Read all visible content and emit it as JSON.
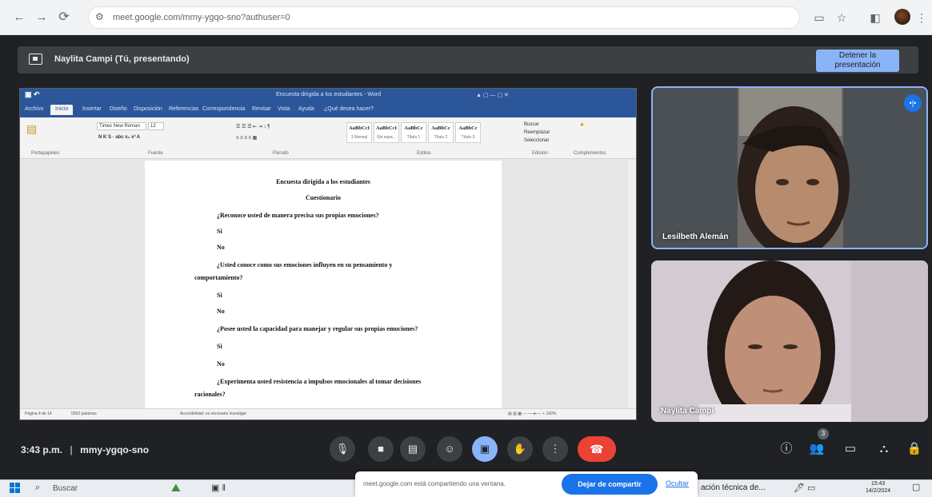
{
  "browser": {
    "url": "meet.google.com/mmy-ygqo-sno?authuser=0",
    "back_icon": "←",
    "forward_icon": "→",
    "reload_icon": "⟳"
  },
  "meet": {
    "presenting_label": "Naylita Campi (Tú, presentando)",
    "stop_presenting_label": "Detener la presentación",
    "time": "3:43 p.m.",
    "separator": "|",
    "meeting_code": "mmy-ygqo-sno",
    "participants_count": "3"
  },
  "word": {
    "title": "Encuesta dirigida a los estudiantes - Word",
    "tabs": [
      "Archivo",
      "Inicio",
      "Insertar",
      "Diseño",
      "Disposición",
      "Referencias",
      "Correspondencia",
      "Revisar",
      "Vista",
      "Ayuda",
      "¿Qué desea hacer?"
    ],
    "font_name": "Times New Roman",
    "font_size": "12",
    "styles": [
      {
        "sample": "AaBbCcI",
        "name": "1 Normal"
      },
      {
        "sample": "AaBbCcI",
        "name": "Sin espa..."
      },
      {
        "sample": "AaBbCc",
        "name": "Título 1"
      },
      {
        "sample": "AaBbCc",
        "name": "Título 2"
      },
      {
        "sample": "AaBbCc",
        "name": "Título 3"
      }
    ],
    "ribbon_groups": [
      "Portapapeles",
      "Fuente",
      "Párrafo",
      "Estilos",
      "Edición",
      "Complementos"
    ],
    "edit_buttons": [
      "Buscar",
      "Reemplazar",
      "Seleccionar"
    ],
    "status_left": "Página 4 de 14",
    "status_words": "5562 palabras",
    "status_access": "Accesibilidad: es necesario investigar",
    "document": {
      "heading": "Encuesta dirigida a los estudiantes",
      "subheading": "Cuestionario",
      "q1": "¿Reconoce usted de manera precisa sus propias emociones?",
      "q2a": "¿Usted conoce como sus emociones influyen en su pensamiento y",
      "q2b": "comportamiento?",
      "q3": "¿Posee usted la capacidad para manejar y regular sus propias emociones?",
      "q4a": "¿Experimenta usted resistencia a impulsos emocionales al tomar decisiones",
      "q4b": "racionales?",
      "yes": "Si",
      "no": "No"
    }
  },
  "tiles": [
    {
      "name": "Lesilbeth Alemán"
    },
    {
      "name": "Naylita Campi"
    }
  ],
  "taskbar": {
    "search_placeholder": "Buscar",
    "share_message": "meet.google.com está compartiendo una ventana.",
    "stop_sharing_label": "Dejar de compartir",
    "hide_label": "Ocultar",
    "task_label": "ación técnica de...",
    "time": "15:43",
    "date": "14/2/2024"
  },
  "colors": {
    "meet_bg": "#202124",
    "accent_blue": "#8ab4f8",
    "end_call_red": "#ea4335",
    "word_blue": "#2b579a"
  }
}
